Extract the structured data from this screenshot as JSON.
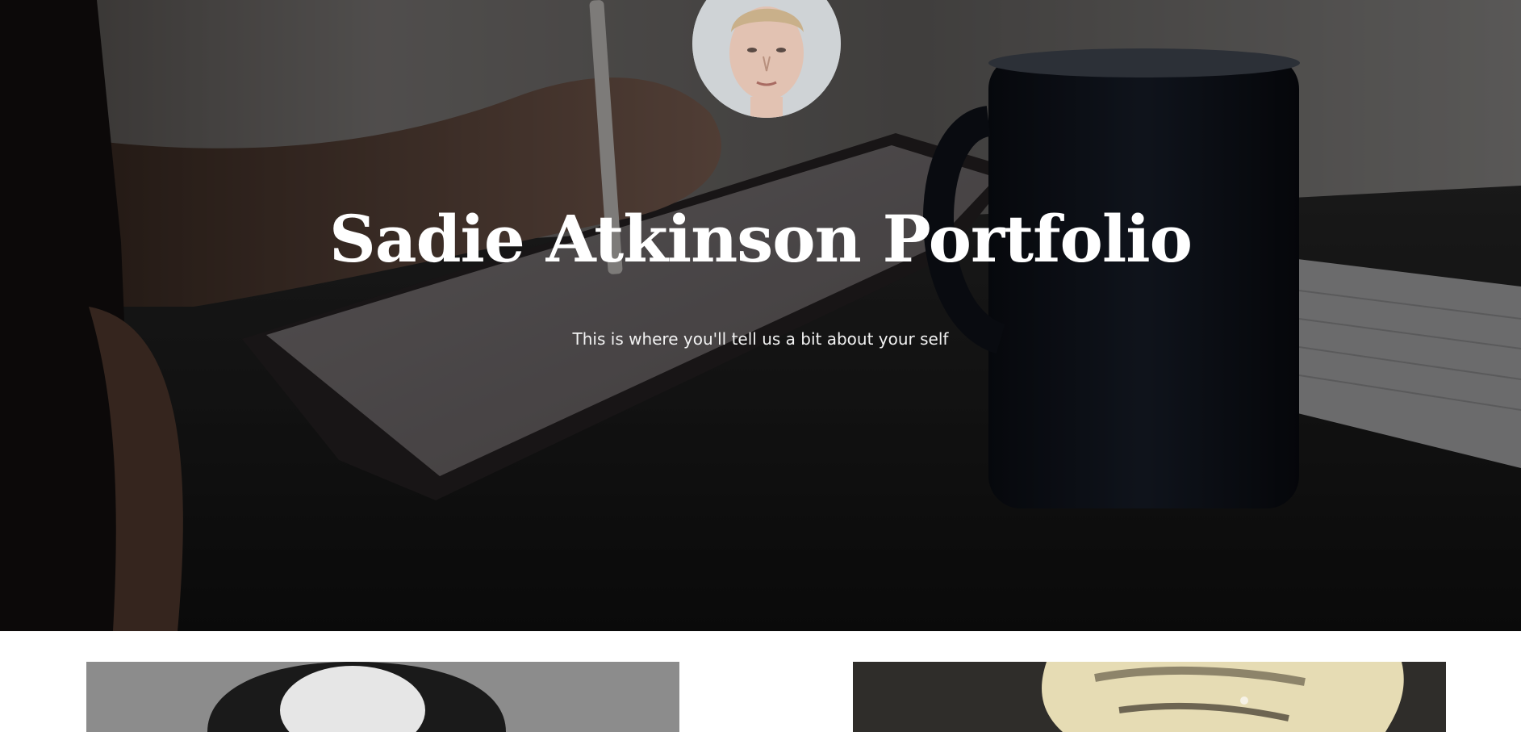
{
  "hero": {
    "title": "Sadie Atkinson Portfolio",
    "subtitle": "This is where you'll tell us a bit about your self",
    "background_description_icon": "desk-photo-image",
    "overlay_color": "#000000"
  },
  "avatar": {
    "icon": "profile-photo"
  },
  "gallery": {
    "items": [
      {
        "icon": "portrait-artwork-bw"
      },
      {
        "icon": "portrait-artwork-sketch"
      }
    ]
  },
  "colors": {
    "title_text": "#ffffff",
    "subtitle_text": "#f2f2f2",
    "page_background": "#ffffff"
  }
}
